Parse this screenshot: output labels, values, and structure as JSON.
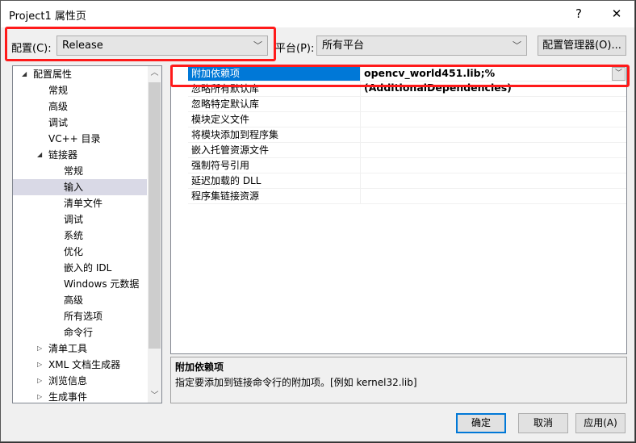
{
  "window": {
    "title": "Project1 属性页",
    "help": "?",
    "close": "✕"
  },
  "config": {
    "label": "配置(C):",
    "value": "Release"
  },
  "platform": {
    "label": "平台(P):",
    "value": "所有平台"
  },
  "config_manager": "配置管理器(O)...",
  "tree": [
    {
      "label": "配置属性",
      "level": 0,
      "expander": "expanded"
    },
    {
      "label": "常规",
      "level": 1
    },
    {
      "label": "高级",
      "level": 1
    },
    {
      "label": "调试",
      "level": 1
    },
    {
      "label": "VC++ 目录",
      "level": 1
    },
    {
      "label": "链接器",
      "level": 1,
      "expander": "expanded"
    },
    {
      "label": "常规",
      "level": 2
    },
    {
      "label": "输入",
      "level": 2,
      "selected": true
    },
    {
      "label": "清单文件",
      "level": 2
    },
    {
      "label": "调试",
      "level": 2
    },
    {
      "label": "系统",
      "level": 2
    },
    {
      "label": "优化",
      "level": 2
    },
    {
      "label": "嵌入的 IDL",
      "level": 2
    },
    {
      "label": "Windows 元数据",
      "level": 2
    },
    {
      "label": "高级",
      "level": 2
    },
    {
      "label": "所有选项",
      "level": 2
    },
    {
      "label": "命令行",
      "level": 2
    },
    {
      "label": "清单工具",
      "level": 1,
      "expander": "collapsed"
    },
    {
      "label": "XML 文档生成器",
      "level": 1,
      "expander": "collapsed"
    },
    {
      "label": "浏览信息",
      "level": 1,
      "expander": "collapsed"
    },
    {
      "label": "生成事件",
      "level": 1,
      "expander": "collapsed"
    }
  ],
  "properties": [
    {
      "name": "附加依赖项",
      "value": "opencv_world451.lib;%(AdditionalDependencies)",
      "selected": true
    },
    {
      "name": "忽略所有默认库",
      "value": ""
    },
    {
      "name": "忽略特定默认库",
      "value": ""
    },
    {
      "name": "模块定义文件",
      "value": ""
    },
    {
      "name": "将模块添加到程序集",
      "value": ""
    },
    {
      "name": "嵌入托管资源文件",
      "value": ""
    },
    {
      "name": "强制符号引用",
      "value": ""
    },
    {
      "name": "延迟加载的 DLL",
      "value": ""
    },
    {
      "name": "程序集链接资源",
      "value": ""
    }
  ],
  "description": {
    "title": "附加依赖项",
    "text": "指定要添加到链接命令行的附加项。[例如 kernel32.lib]"
  },
  "buttons": {
    "ok": "确定",
    "cancel": "取消",
    "apply": "应用(A)"
  },
  "colors": {
    "selection": "#0078d7",
    "highlight_box": "#ff1a1a"
  }
}
